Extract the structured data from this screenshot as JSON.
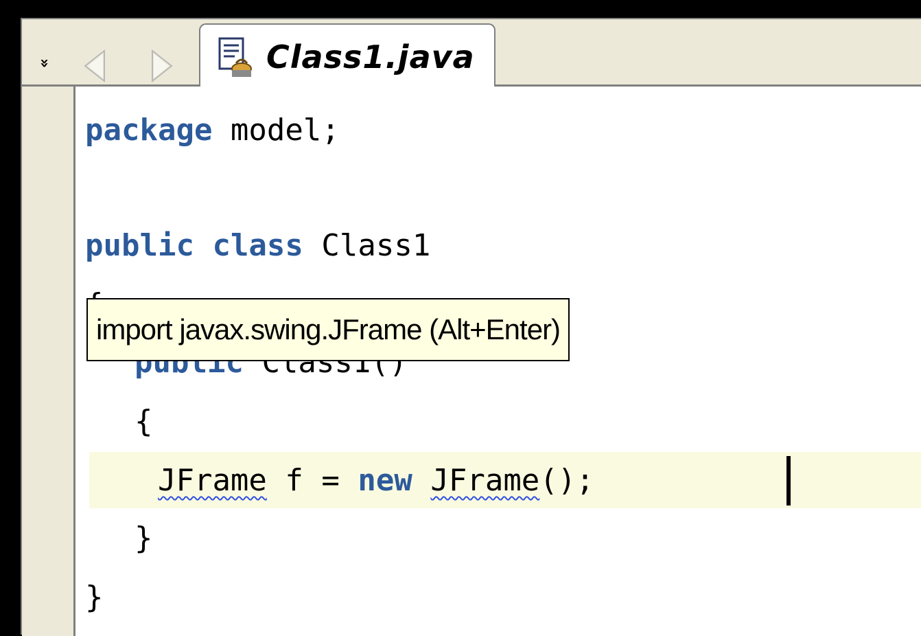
{
  "nav": {
    "overflow_glyph": "»",
    "back_icon": "back-arrow-icon",
    "forward_icon": "forward-arrow-icon"
  },
  "tab": {
    "label": "Class1.java",
    "icon": "java-file-icon"
  },
  "code": {
    "lines": [
      {
        "kw": "package",
        "rest": " model;"
      },
      {
        "kw": "",
        "rest": ""
      },
      {
        "kw1": "public",
        "kw2": "class",
        "rest": " Class1"
      },
      {
        "text": "{"
      },
      {
        "kw": "public",
        "rest": " Class1()"
      },
      {
        "text": "{"
      },
      {
        "indent": "    ",
        "type1": "JFrame",
        "mid": " f = ",
        "kw": "new",
        "sp": " ",
        "type2": "JFrame",
        "tail": "();"
      },
      {
        "text": "}"
      },
      {
        "text": "}"
      }
    ]
  },
  "tooltip": {
    "text": "import javax.swing.JFrame (Alt+Enter)"
  },
  "colors": {
    "keyword": "#2c5a9b",
    "current_line": "#fafae0",
    "tooltip_bg": "#ffffe1",
    "chrome": "#ece9d8",
    "squiggle": "#3050e0"
  }
}
